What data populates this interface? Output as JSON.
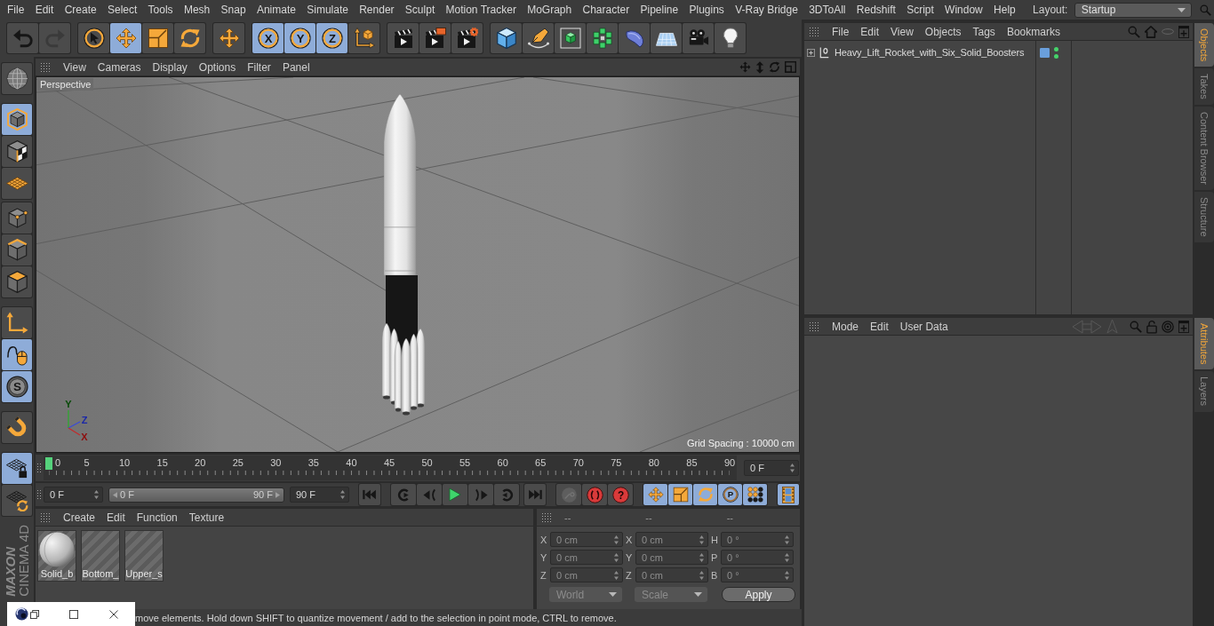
{
  "menu_bar": {
    "items": [
      "File",
      "Edit",
      "Create",
      "Select",
      "Tools",
      "Mesh",
      "Snap",
      "Animate",
      "Simulate",
      "Render",
      "Sculpt",
      "Motion Tracker",
      "MoGraph",
      "Character",
      "Pipeline",
      "Plugins",
      "V-Ray Bridge",
      "3DToAll",
      "Redshift",
      "Script",
      "Window",
      "Help"
    ],
    "layout_label": "Layout:",
    "layout_value": "Startup"
  },
  "toolbar": {
    "groups": [
      {
        "tools": [
          {
            "kind": "undo",
            "disabled": false
          },
          {
            "kind": "redo",
            "disabled": true
          }
        ]
      },
      {
        "tools": [
          {
            "kind": "select",
            "selected": false
          },
          {
            "kind": "move",
            "selected": true
          },
          {
            "kind": "scale",
            "selected": false
          },
          {
            "kind": "rotate",
            "selected": false
          }
        ]
      },
      {
        "tools": [
          {
            "kind": "transform",
            "selected": false
          }
        ]
      },
      {
        "tools": [
          {
            "kind": "axis",
            "label": "X",
            "selected": true
          },
          {
            "kind": "axis",
            "label": "Y",
            "selected": true
          },
          {
            "kind": "axis",
            "label": "Z",
            "selected": true
          },
          {
            "kind": "coords",
            "selected": false
          }
        ]
      },
      {
        "tools": [
          {
            "kind": "renderview"
          },
          {
            "kind": "renderpicture"
          },
          {
            "kind": "rendersettings"
          }
        ]
      },
      {
        "tools": [
          {
            "kind": "cube"
          },
          {
            "kind": "pen"
          },
          {
            "kind": "subdivision"
          },
          {
            "kind": "cloner"
          },
          {
            "kind": "deformer"
          },
          {
            "kind": "floor"
          },
          {
            "kind": "camera"
          },
          {
            "kind": "light"
          }
        ]
      }
    ]
  },
  "left_toolbar": {
    "groups": [
      {
        "tools": [
          {
            "kind": "globe",
            "selected": false
          }
        ]
      },
      {
        "tools": [
          {
            "kind": "model",
            "selected": true
          },
          {
            "kind": "texture",
            "selected": false
          },
          {
            "kind": "workplane",
            "selected": false
          }
        ]
      },
      {
        "tools": [
          {
            "kind": "points",
            "selected": false
          },
          {
            "kind": "edges",
            "selected": false
          },
          {
            "kind": "polygons",
            "selected": false
          }
        ]
      },
      {
        "tools": [
          {
            "kind": "axes",
            "selected": false
          },
          {
            "kind": "tweak",
            "selected": true
          },
          {
            "kind": "snap",
            "label": "S",
            "selected": true
          }
        ]
      },
      {
        "tools": [
          {
            "kind": "magnet",
            "selected": false
          }
        ]
      },
      {
        "tools": [
          {
            "kind": "gridlock",
            "selected": true
          },
          {
            "kind": "gridrotate",
            "selected": false
          }
        ]
      }
    ]
  },
  "logo": {
    "brand": "MAXON",
    "product": "CINEMA 4D"
  },
  "viewport": {
    "menu": [
      "View",
      "Cameras",
      "Display",
      "Options",
      "Filter",
      "Panel"
    ],
    "camera": "Perspective",
    "axes": [
      "Y",
      "Z",
      "X"
    ],
    "grid_spacing": "Grid Spacing : 10000 cm"
  },
  "timeline": {
    "ticks": [
      "0",
      "5",
      "10",
      "15",
      "20",
      "25",
      "30",
      "35",
      "40",
      "45",
      "50",
      "55",
      "60",
      "65",
      "70",
      "75",
      "80",
      "85",
      "90"
    ],
    "playhead": {
      "level": 0
    },
    "frame_field": "0 F",
    "start_field": "0 F",
    "range": {
      "start": "0 F",
      "end": "90 F",
      "level": 1
    },
    "end_field": "90 F",
    "transport": [
      {
        "tools": [
          {
            "kind": "first"
          }
        ]
      },
      {
        "tools": [
          {
            "kind": "prevkey"
          },
          {
            "kind": "prevframe"
          },
          {
            "kind": "play"
          },
          {
            "kind": "nextframe"
          },
          {
            "kind": "nextkey"
          }
        ]
      },
      {
        "tools": [
          {
            "kind": "last"
          }
        ]
      }
    ],
    "record": [
      {
        "kind": "keyframe",
        "disabled": true
      },
      {
        "kind": "record",
        "disabled": false
      },
      {
        "kind": "autokey",
        "label": "?",
        "disabled": false
      }
    ],
    "key_filters": [
      {
        "kind": "position",
        "selected": true
      },
      {
        "kind": "scaling",
        "selected": true
      },
      {
        "kind": "rotation",
        "selected": true
      },
      {
        "kind": "param",
        "label": "P",
        "selected": true
      },
      {
        "kind": "pla",
        "selected": true
      }
    ],
    "timeline_button": {
      "kind": "film",
      "selected": true
    }
  },
  "materials": {
    "menu": [
      "Create",
      "Edit",
      "Function",
      "Texture"
    ],
    "items": [
      {
        "name": "Solid_b",
        "kind": "sphere"
      },
      {
        "name": "Bottom_",
        "kind": "blank"
      },
      {
        "name": "Upper_s",
        "kind": "blank"
      }
    ]
  },
  "coordinates": {
    "headers": [
      "--",
      "--",
      "--"
    ],
    "rows": [
      {
        "cells": [
          {
            "axis": "X",
            "value": "0 cm"
          },
          {
            "axis": "X",
            "value": "0 cm"
          },
          {
            "axis": "H",
            "value": "0 °"
          }
        ]
      },
      {
        "cells": [
          {
            "axis": "Y",
            "value": "0 cm"
          },
          {
            "axis": "Y",
            "value": "0 cm"
          },
          {
            "axis": "P",
            "value": "0 °"
          }
        ]
      },
      {
        "cells": [
          {
            "axis": "Z",
            "value": "0 cm"
          },
          {
            "axis": "Z",
            "value": "0 cm"
          },
          {
            "axis": "B",
            "value": "0 °"
          }
        ]
      }
    ],
    "mode": {
      "value": "World",
      "disabled": true
    },
    "transform": {
      "value": "Scale",
      "disabled": true
    },
    "apply": "Apply"
  },
  "status_bar": {
    "text": "move elements. Hold down SHIFT to quantize movement / add to the selection in point mode, CTRL to remove."
  },
  "object_manager": {
    "menu": [
      "File",
      "Edit",
      "View",
      "Objects",
      "Tags",
      "Bookmarks"
    ],
    "objects": [
      {
        "name": "Heavy_Lift_Rocket_with_Six_Solid_Boosters",
        "expanded": false
      }
    ]
  },
  "attributes": {
    "menu": [
      "Mode",
      "Edit",
      "User Data"
    ],
    "history": {
      "disabled": true
    }
  },
  "side_tabs": {
    "upper": [
      {
        "label": "Objects",
        "selected": true
      },
      {
        "label": "Takes",
        "selected": false
      },
      {
        "label": "Content Browser",
        "selected": false
      },
      {
        "label": "Structure",
        "selected": false
      }
    ],
    "lower": [
      {
        "label": "Attributes",
        "selected": true
      },
      {
        "label": "Layers",
        "selected": false
      }
    ]
  }
}
